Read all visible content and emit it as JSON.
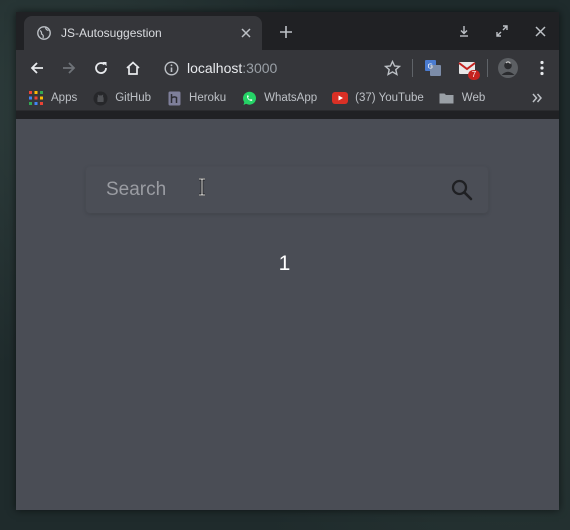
{
  "browser": {
    "tab": {
      "title": "JS-Autosuggestion",
      "favicon": "globe-icon"
    },
    "address": {
      "host": "localhost",
      "port": ":3000"
    },
    "extension_badge": "7",
    "bookmarks": [
      {
        "label": "Apps",
        "icon": "apps-grid-icon"
      },
      {
        "label": "GitHub",
        "icon": "github-icon"
      },
      {
        "label": "Heroku",
        "icon": "heroku-icon"
      },
      {
        "label": "WhatsApp",
        "icon": "whatsapp-icon"
      },
      {
        "label": "(37) YouTube",
        "icon": "youtube-icon"
      },
      {
        "label": "Web",
        "icon": "folder-icon"
      }
    ]
  },
  "app": {
    "search": {
      "placeholder": "Search",
      "value": ""
    },
    "result_count": "1"
  },
  "colors": {
    "page_background": "#4a4d55",
    "chrome_frame": "#202124",
    "chrome_toolbar": "#35363a",
    "text_primary": "#ffffff"
  }
}
